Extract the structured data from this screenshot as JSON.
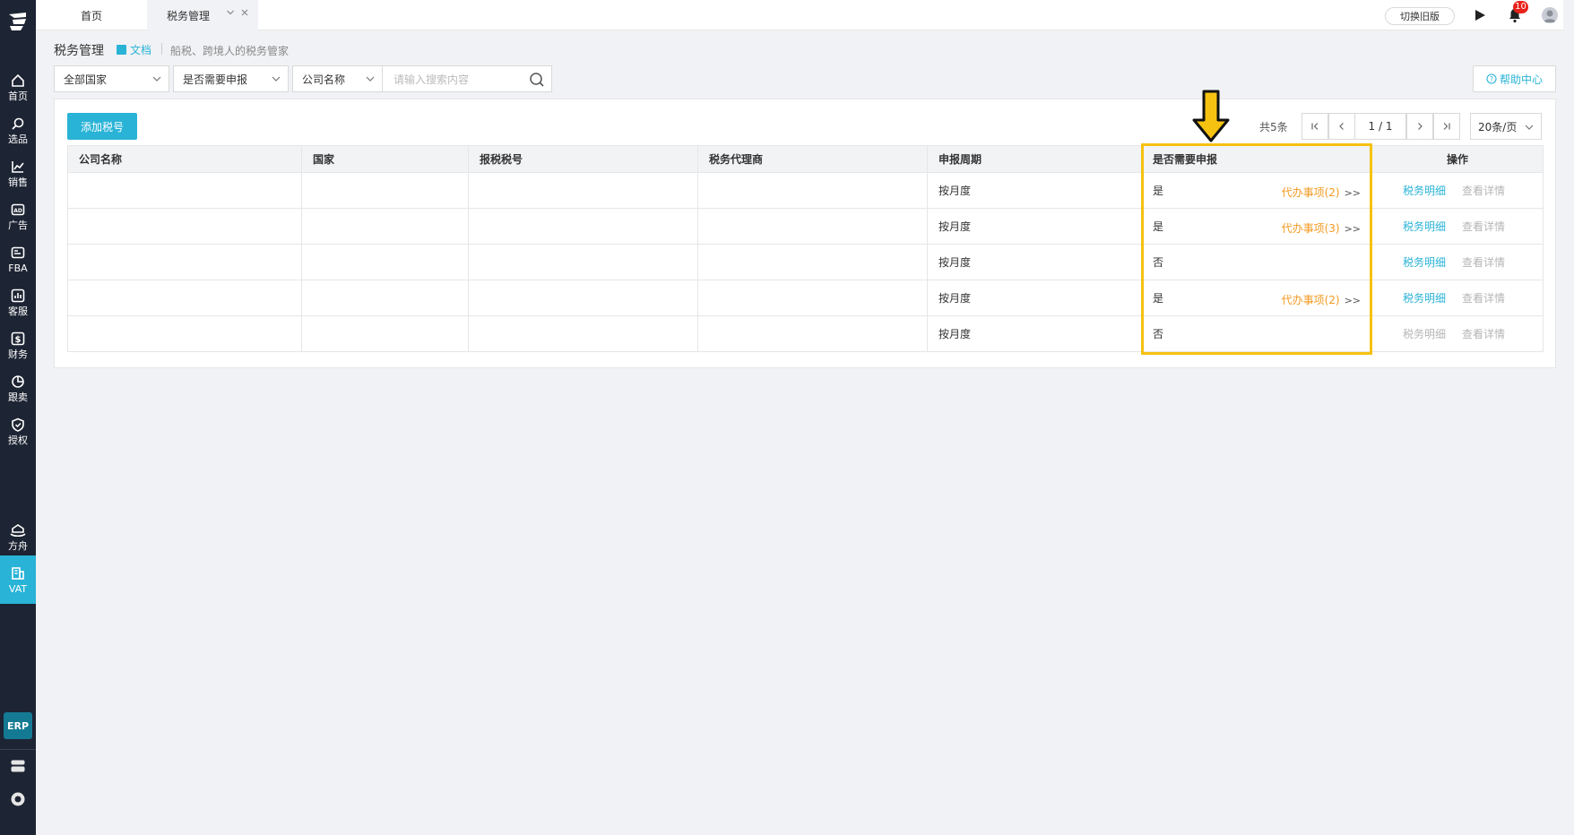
{
  "sidebar": {
    "items": [
      {
        "label": "首页",
        "icon": "home-icon"
      },
      {
        "label": "选品",
        "icon": "search-icon"
      },
      {
        "label": "销售",
        "icon": "trend-icon"
      },
      {
        "label": "广告",
        "icon": "ad-icon"
      },
      {
        "label": "FBA",
        "icon": "fba-icon"
      },
      {
        "label": "客服",
        "icon": "chart-icon"
      },
      {
        "label": "财务",
        "icon": "dollar-icon"
      },
      {
        "label": "跟卖",
        "icon": "pie-icon"
      },
      {
        "label": "授权",
        "icon": "shield-icon"
      },
      {
        "label": "方舟",
        "icon": "ark-icon"
      },
      {
        "label": "VAT",
        "icon": "building-icon",
        "active": true
      }
    ],
    "erp_label": "ERP"
  },
  "tabs": {
    "home": "首页",
    "current": "税务管理"
  },
  "topbar": {
    "switch_label": "切换旧版",
    "notification_count": "10"
  },
  "page": {
    "title": "税务管理",
    "doc_link": "文档",
    "description": "船税、跨境人的税务管家"
  },
  "filters": {
    "country": "全部国家",
    "declare": "是否需要申报",
    "field": "公司名称",
    "search_placeholder": "请输入搜索内容",
    "help": "帮助中心"
  },
  "toolbar": {
    "add_label": "添加税号",
    "total": "共5条",
    "page_indicator": "1 / 1",
    "page_size": "20条/页"
  },
  "table": {
    "headers": [
      "公司名称",
      "国家",
      "报税税号",
      "税务代理商",
      "申报周期",
      "是否需要申报",
      "操作"
    ],
    "rows": [
      {
        "period": "按月度",
        "declare": "是",
        "todo": "代办事项(2)",
        "detail_link": "税务明细",
        "detail_enabled": true,
        "view": "查看详情"
      },
      {
        "period": "按月度",
        "declare": "是",
        "todo": "代办事项(3)",
        "detail_link": "税务明细",
        "detail_enabled": true,
        "view": "查看详情"
      },
      {
        "period": "按月度",
        "declare": "否",
        "todo": "",
        "detail_link": "税务明细",
        "detail_enabled": true,
        "view": "查看详情"
      },
      {
        "period": "按月度",
        "declare": "是",
        "todo": "代办事项(2)",
        "detail_link": "税务明细",
        "detail_enabled": true,
        "view": "查看详情"
      },
      {
        "period": "按月度",
        "declare": "否",
        "todo": "",
        "detail_link": "税务明细",
        "detail_enabled": false,
        "view": "查看详情"
      }
    ],
    "todo_arrow": ">>"
  },
  "colors": {
    "accent": "#29b3d6",
    "sidebar_bg": "#1d2433",
    "todo_orange": "#f39a21",
    "highlight": "#f5c211"
  }
}
